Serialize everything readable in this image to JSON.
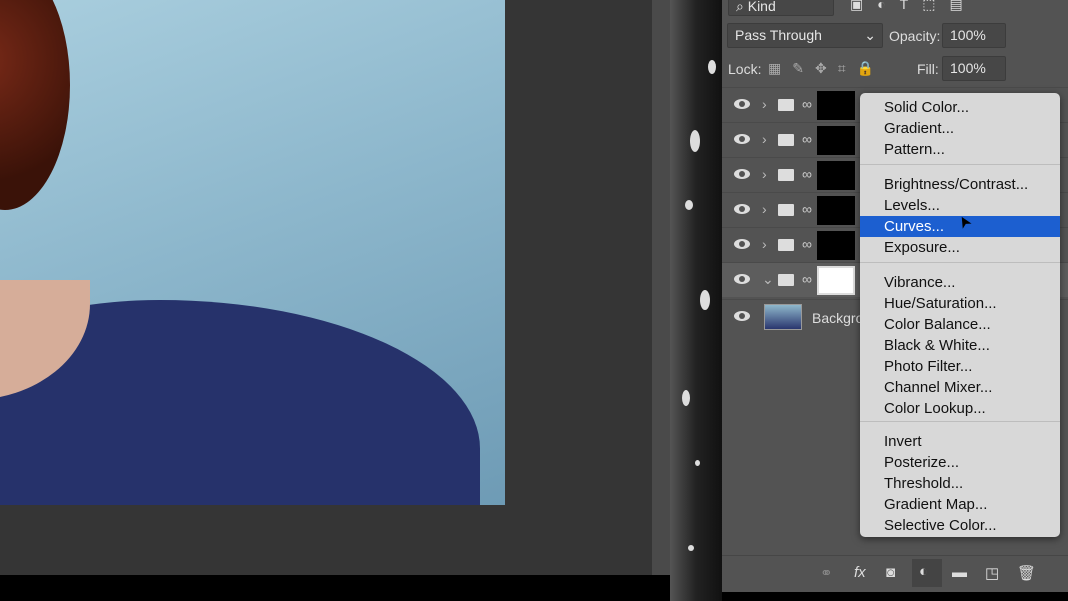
{
  "layers_panel": {
    "filter_kind": "Kind",
    "blend_mode": "Pass Through",
    "opacity_label": "Opacity:",
    "opacity_value": "100%",
    "lock_label": "Lock:",
    "fill_label": "Fill:",
    "fill_value": "100%",
    "background_layer": "Backgro"
  },
  "adjustment_menu": {
    "items": [
      "Solid Color...",
      "Gradient...",
      "Pattern...",
      "Brightness/Contrast...",
      "Levels...",
      "Curves...",
      "Exposure...",
      "Vibrance...",
      "Hue/Saturation...",
      "Color Balance...",
      "Black & White...",
      "Photo Filter...",
      "Channel Mixer...",
      "Color Lookup...",
      "Invert",
      "Posterize...",
      "Threshold...",
      "Gradient Map...",
      "Selective Color..."
    ],
    "selected": "Curves...",
    "highlight_color": "#1c5fd0"
  },
  "bottom_bar": {
    "fx_label": "fx"
  }
}
